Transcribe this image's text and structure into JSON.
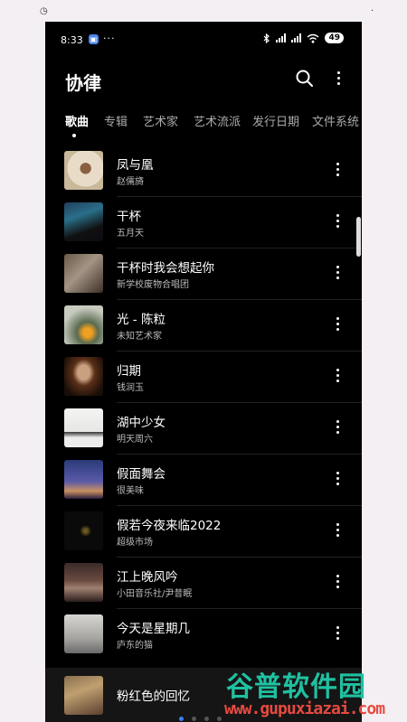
{
  "status_bar": {
    "time": "8:33",
    "more": "···",
    "battery": "49"
  },
  "header": {
    "title": "协律"
  },
  "tabs": [
    "歌曲",
    "专辑",
    "艺术家",
    "艺术流派",
    "发行日期",
    "文件系统"
  ],
  "songs": [
    {
      "title": "凤与凰",
      "artist": "赵儒旖"
    },
    {
      "title": "干杯",
      "artist": "五月天"
    },
    {
      "title": "干杯时我会想起你",
      "artist": "新学校废物合唱团"
    },
    {
      "title": "光 - 陈粒",
      "artist": "未知艺术家"
    },
    {
      "title": "归期",
      "artist": "钱润玉"
    },
    {
      "title": "湖中少女",
      "artist": "明天周六"
    },
    {
      "title": "假面舞会",
      "artist": "很美味"
    },
    {
      "title": "假若今夜来临2022",
      "artist": "超级市场"
    },
    {
      "title": "江上晚风吟",
      "artist": "小田音乐社/尹昔眠"
    },
    {
      "title": "今天是星期几",
      "artist": "庐东的猫"
    }
  ],
  "now_playing": {
    "title": "粉红色的回忆"
  },
  "watermark": {
    "title": "谷普软件园",
    "url": "www.gupuxiazai.com"
  },
  "colors": {
    "accent": "#3a80f0",
    "watermark_green": "#1fc1a0",
    "watermark_red": "#e64a40"
  },
  "icons": [
    "search-icon",
    "more-vertical-icon",
    "bluetooth-icon",
    "signal-icon",
    "wifi-icon",
    "battery-icon"
  ]
}
